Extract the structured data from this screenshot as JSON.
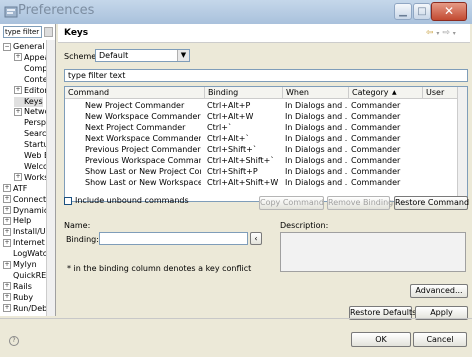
{
  "window": {
    "title": "Preferences"
  },
  "tree": {
    "filter_value": "type filter",
    "nodes": [
      {
        "label": "General",
        "expander": "−",
        "indent": 0
      },
      {
        "label": "Appearance",
        "expander": "+",
        "indent": 1
      },
      {
        "label": "Compare/Patch",
        "expander": "",
        "indent": 1
      },
      {
        "label": "Content Types",
        "expander": "",
        "indent": 1
      },
      {
        "label": "Editors",
        "expander": "+",
        "indent": 1
      },
      {
        "label": "Keys",
        "expander": "",
        "indent": 1,
        "selected": true
      },
      {
        "label": "Network Connections",
        "expander": "+",
        "indent": 1
      },
      {
        "label": "Perspectives",
        "expander": "",
        "indent": 1
      },
      {
        "label": "Search",
        "expander": "",
        "indent": 1
      },
      {
        "label": "Startup and Shutdown",
        "expander": "",
        "indent": 1
      },
      {
        "label": "Web Browser",
        "expander": "",
        "indent": 1
      },
      {
        "label": "Welcome",
        "expander": "",
        "indent": 1
      },
      {
        "label": "Workspace",
        "expander": "+",
        "indent": 1
      },
      {
        "label": "ATF",
        "expander": "+",
        "indent": 0
      },
      {
        "label": "Connectivity",
        "expander": "+",
        "indent": 0
      },
      {
        "label": "Dynamic Languages",
        "expander": "+",
        "indent": 0
      },
      {
        "label": "Help",
        "expander": "+",
        "indent": 0
      },
      {
        "label": "Install/Update",
        "expander": "+",
        "indent": 0
      },
      {
        "label": "Internet",
        "expander": "+",
        "indent": 0
      },
      {
        "label": "LogWatcher",
        "expander": "",
        "indent": 0
      },
      {
        "label": "Mylyn",
        "expander": "+",
        "indent": 0
      },
      {
        "label": "QuickREx",
        "expander": "",
        "indent": 0
      },
      {
        "label": "Rails",
        "expander": "+",
        "indent": 0
      },
      {
        "label": "Ruby",
        "expander": "+",
        "indent": 0
      },
      {
        "label": "Run/Debug",
        "expander": "+",
        "indent": 0
      }
    ]
  },
  "page": {
    "title": "Keys",
    "nav": {
      "back": "⇦",
      "forward": "⇨"
    },
    "scheme_label": "Scheme:",
    "scheme_value": "Default",
    "filter_placeholder": "type filter text",
    "columns": [
      "Command",
      "Binding",
      "When",
      "Category",
      "User"
    ],
    "sort_indicator": "▲",
    "rows": [
      {
        "command": "New Project Commander",
        "binding": "Ctrl+Alt+P",
        "when": "In Dialogs and ...",
        "category": "Commander",
        "user": ""
      },
      {
        "command": "New Workspace Commander",
        "binding": "Ctrl+Alt+W",
        "when": "In Dialogs and ...",
        "category": "Commander",
        "user": ""
      },
      {
        "command": "Next Project Commander",
        "binding": "Ctrl+`",
        "when": "In Dialogs and ...",
        "category": "Commander",
        "user": ""
      },
      {
        "command": "Next Workspace Commander",
        "binding": "Ctrl+Alt+`",
        "when": "In Dialogs and ...",
        "category": "Commander",
        "user": ""
      },
      {
        "command": "Previous Project Commander",
        "binding": "Ctrl+Shift+`",
        "when": "In Dialogs and ...",
        "category": "Commander",
        "user": ""
      },
      {
        "command": "Previous Workspace Commander",
        "binding": "Ctrl+Alt+Shift+`",
        "when": "In Dialogs and ...",
        "category": "Commander",
        "user": ""
      },
      {
        "command": "Show Last or New Project Comm",
        "binding": "Ctrl+Shift+P",
        "when": "In Dialogs and ...",
        "category": "Commander",
        "user": ""
      },
      {
        "command": "Show Last or New Workspace Co",
        "binding": "Ctrl+Alt+Shift+W",
        "when": "In Dialogs and ...",
        "category": "Commander",
        "user": ""
      }
    ],
    "include_unbound_label": "Include unbound commands",
    "copy_command": "Copy Command",
    "remove_binding": "Remove Binding",
    "restore_command": "Restore Command",
    "name_label": "Name:",
    "binding_label": "Binding:",
    "description_label": "Description:",
    "note": "* in the binding column denotes a key conflict",
    "advanced": "Advanced...",
    "restore_defaults": "Restore Defaults",
    "apply": "Apply"
  },
  "dialog": {
    "ok": "OK",
    "cancel": "Cancel",
    "help_glyph": "?"
  }
}
